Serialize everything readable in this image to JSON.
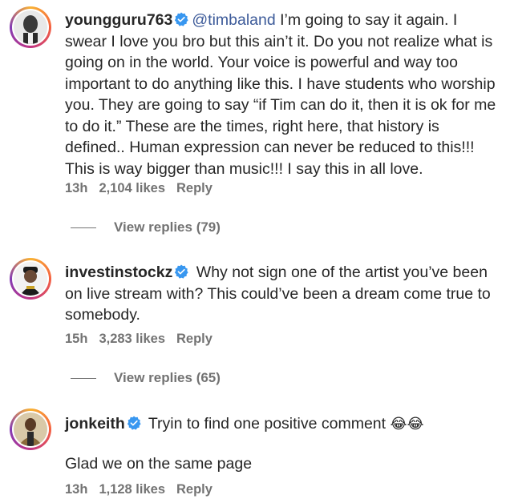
{
  "comments": [
    {
      "username": "youngguru763",
      "mention": "@timbaland",
      "text": " I’m going to say it again. I swear I love you bro but this ain’t it. Do you not realize what is going on in the world. Your voice is powerful and way too important to do anything like this. I have students who worship you. They are going to say “if Tim can do it, then it is ok for me to do it.” These are the times, right here, that history is defined.. Human expression can never be reduced to this!!! This is way bigger than music!!! I say this in all love.",
      "time": "13h",
      "likes": "2,104 likes",
      "reply_label": "Reply",
      "view_replies": "View replies (79)"
    },
    {
      "username": "investinstockz",
      "text": " Why not sign one of the artist you’ve been on live stream with? This could’ve been a dream come true to somebody.",
      "time": "15h",
      "likes": "3,283 likes",
      "reply_label": "Reply",
      "view_replies": "View replies (65)"
    },
    {
      "username": "jonkeith",
      "text": " Tryin to find one positive comment ",
      "emoji": "😂😂",
      "text2": "Glad we on the same page",
      "time": "13h",
      "likes": "1,128 likes",
      "reply_label": "Reply"
    }
  ],
  "colors": {
    "text": "#262626",
    "meta": "#737373",
    "mention": "#3c5a99",
    "verified": "#3897f0"
  },
  "icons": [
    "verified-badge-icon",
    "avatar"
  ]
}
